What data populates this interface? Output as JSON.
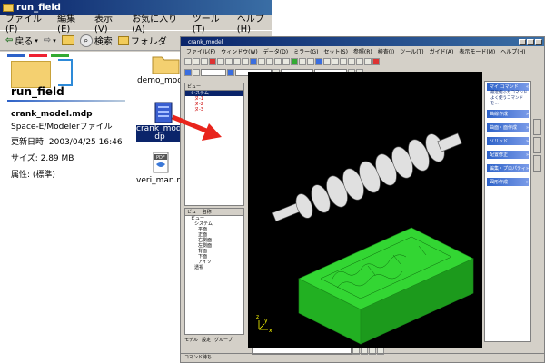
{
  "explorer": {
    "title": "run_field",
    "menu": [
      "ファイル(F)",
      "編集(E)",
      "表示(V)",
      "お気に入り(A)",
      "ツール(T)",
      "ヘルプ(H)"
    ],
    "toolbar": {
      "back": "戻る",
      "search": "検索",
      "folders": "フォルダ"
    },
    "folder_name": "run_field",
    "selected_file": {
      "name": "crank_model.mdp",
      "type": "Space-E/Modelerファイル",
      "modified": "更新日時: 2003/04/25 16:46",
      "size": "サイズ: 2.89 MB",
      "attributes": "属性: (標準)"
    },
    "files": [
      {
        "label": "demo_model"
      },
      {
        "label": "crank_model.m dp"
      },
      {
        "label": "veri_man.mdp"
      }
    ]
  },
  "cad": {
    "title": "crank_model",
    "menu": [
      "ファイル(F)",
      "ウィンドウ(W)",
      "データ(D)",
      "ミラー(G)",
      "セット(S)",
      "参照(R)",
      "検査(I)",
      "ツール(T)",
      "ガイド(A)",
      "表示モード(M)",
      "ヘルプ(H)"
    ],
    "tree_top": {
      "header": "ビュー",
      "nodes": [
        "システム",
        "ヌ-1",
        "ヌ-2",
        "ヌ-3"
      ]
    },
    "tree_bottom": {
      "header": "ビュー 名称",
      "nodes": [
        "ビュー",
        "システム",
        "平面",
        "正面",
        "右側面",
        "左側面",
        "背面",
        "下面",
        "アイソ",
        "透視"
      ]
    },
    "tree_tabs": [
      "モデル",
      "設定",
      "グループ"
    ],
    "right_panel": {
      "sections": [
        {
          "title": "マイ コマンド",
          "items": [
            "最近使ったコマンド",
            "よく使うコマンドを..."
          ]
        },
        {
          "title": "曲線作成",
          "items": []
        },
        {
          "title": "曲面・面作成",
          "items": []
        },
        {
          "title": "ソリッド",
          "items": []
        },
        {
          "title": "配置修正",
          "items": []
        },
        {
          "title": "編集・プロパティ",
          "items": []
        },
        {
          "title": "図形作成",
          "items": []
        }
      ]
    },
    "status": "コマンド待ち"
  },
  "colors": {
    "mold": "#22c222",
    "mold_dark": "#138a13",
    "shaft": "#d8d8d8",
    "arrow": "#e8241c",
    "viewport_bg": "#000000"
  }
}
